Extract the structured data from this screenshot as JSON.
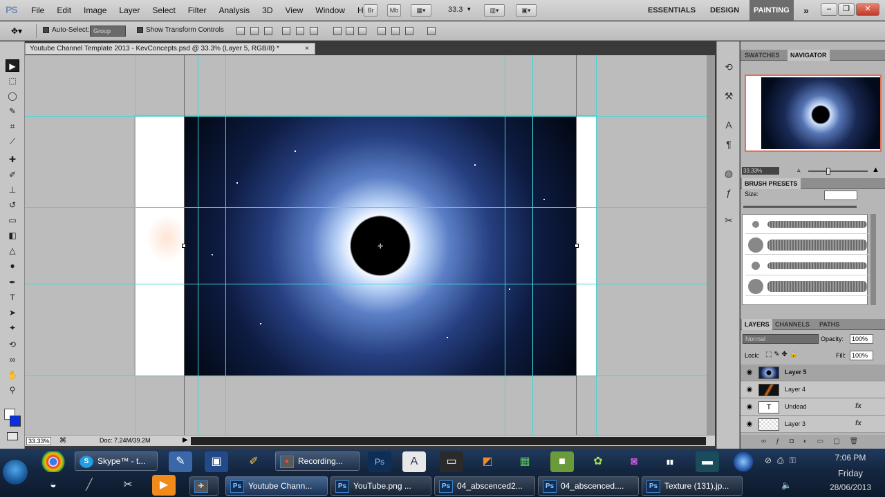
{
  "menubar": {
    "logo": "PS",
    "items": [
      "File",
      "Edit",
      "Image",
      "Layer",
      "Select",
      "Filter",
      "Analysis",
      "3D",
      "View",
      "Window",
      "Help"
    ],
    "bridge_btn": "Br",
    "minibridge_btn": "Mb",
    "zoom": "33.3",
    "workspaces": [
      "ESSENTIALS",
      "DESIGN",
      "PAINTING"
    ],
    "more": "»"
  },
  "options": {
    "auto_select_label": "Auto-Select:",
    "auto_select_value": "Group",
    "transform_label": "Show Transform Controls"
  },
  "document": {
    "tab_title": "Youtube Channel Template 2013 - KevConcepts.psd @ 33.3% (Layer 5, RGB/8) *",
    "close": "×",
    "zoom_status": "33.33%",
    "doc_size": "Doc: 7.24M/39.2M"
  },
  "panels": {
    "top_tabs": [
      "SWATCHES",
      "NAVIGATOR"
    ],
    "nav_zoom": "33.33%",
    "brush_tab": "BRUSH PRESETS",
    "size_label": "Size:",
    "layer_tabs": [
      "LAYERS",
      "CHANNELS",
      "PATHS"
    ],
    "blend_mode": "Normal",
    "opacity_label": "Opacity:",
    "opacity": "100%",
    "lock_label": "Lock:",
    "fill_label": "Fill:",
    "fill": "100%",
    "layers": [
      {
        "name": "Layer 5",
        "thumb": "space",
        "fx": ""
      },
      {
        "name": "Layer 4",
        "thumb": "flame",
        "fx": ""
      },
      {
        "name": "Undead",
        "thumb": "text",
        "fx": "fx"
      },
      {
        "name": "Layer 3",
        "thumb": "transparent",
        "fx": "fx"
      }
    ]
  },
  "taskbar": {
    "skype": "Skype™ - t...",
    "recording": "Recording...",
    "tasks": [
      "Youtube Chann...",
      "YouTube.png ...",
      "04_abscenced2...",
      "04_abscenced....",
      "Texture (131).jp..."
    ],
    "time": "7:06 PM",
    "day": "Friday",
    "date": "28/06/2013"
  },
  "colors": {
    "guide": "#41d6d6",
    "accent_nav": "#e0705a",
    "taskbar": "#14263f"
  }
}
